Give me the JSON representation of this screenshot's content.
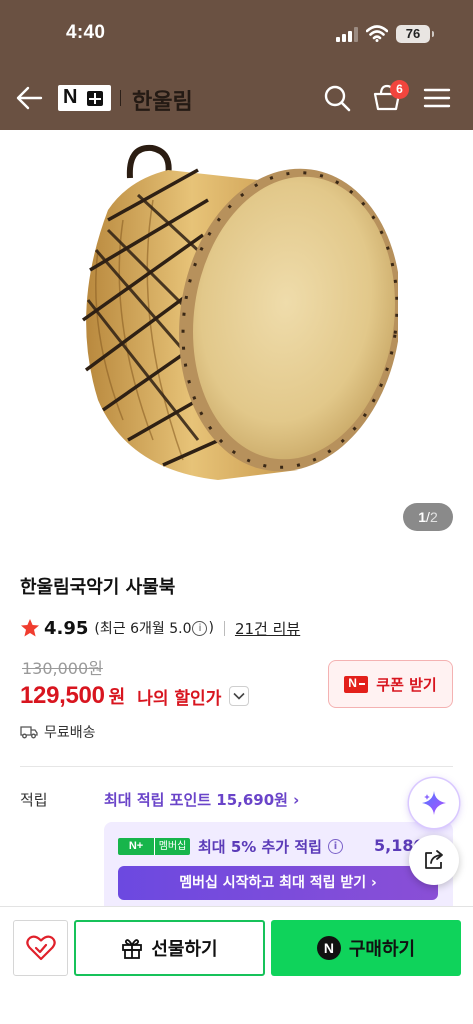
{
  "status_bar": {
    "time": "4:40",
    "battery": "76"
  },
  "nav": {
    "brand_logo": "N+",
    "store_name": "한울림",
    "cart_count": "6",
    "icons": [
      "back-arrow-icon",
      "search-icon",
      "cart-icon",
      "menu-icon"
    ]
  },
  "gallery": {
    "current": "1",
    "separator": "/",
    "total": "2"
  },
  "product": {
    "title": "한울림국악기 사물북",
    "rating": "4.95",
    "recent_rating": "(최근 6개월 5.0",
    "recent_rating_close": ")",
    "info_glyph": "i",
    "review_count": "21건 리뷰"
  },
  "price": {
    "original": "130,000원",
    "sale": "129,500",
    "unit": "원",
    "my_price_label": "나의 할인가"
  },
  "coupon": {
    "logo": "N",
    "label": "쿠폰 받기"
  },
  "shipping": {
    "label": "무료배송"
  },
  "reward": {
    "label": "적립",
    "text": "최대 적립 포인트 15,690원 ›"
  },
  "membership": {
    "logo_n": "N+",
    "logo_text": "멤버십",
    "line": "최대 5% 추가 적립",
    "amount": "5,180",
    "cta": "멤버십 시작하고 최대 적립 받기 ›"
  },
  "bottom": {
    "gift_label": "선물하기",
    "buy_logo": "N",
    "buy_label": "구매하기"
  },
  "colors": {
    "header_bg": "#6a5142",
    "sale_red": "#d8151f",
    "reward_purple": "#6a44c9",
    "naver_green": "#0fd35b"
  }
}
